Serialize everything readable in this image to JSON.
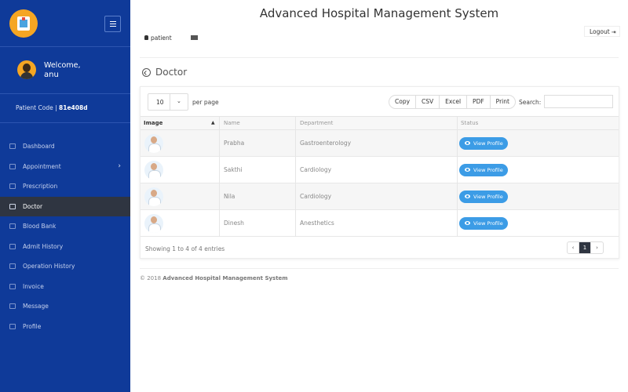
{
  "app": {
    "title": "Advanced Hospital Management System"
  },
  "sidebar": {
    "welcome": "Welcome,",
    "username": "anu",
    "patient_code_label": "Patient Code |",
    "patient_code_value": "81e408d",
    "items": [
      {
        "label": "Dashboard",
        "icon": "monitor-icon"
      },
      {
        "label": "Appointment",
        "icon": "edit-icon",
        "has_submenu": true
      },
      {
        "label": "Prescription",
        "icon": "stethoscope-icon"
      },
      {
        "label": "Doctor",
        "icon": "user-md-icon",
        "active": true
      },
      {
        "label": "Blood Bank",
        "icon": "drop-icon"
      },
      {
        "label": "Admit History",
        "icon": "history-icon"
      },
      {
        "label": "Operation History",
        "icon": "operation-icon"
      },
      {
        "label": "Invoice",
        "icon": "credit-card-icon"
      },
      {
        "label": "Message",
        "icon": "chat-icon"
      },
      {
        "label": "Profile",
        "icon": "user-icon"
      }
    ]
  },
  "header": {
    "user_label": "patient",
    "logout_label": "Logout"
  },
  "page": {
    "title": "Doctor"
  },
  "controls": {
    "page_length": "10",
    "per_page_label": "per page",
    "buttons": [
      "Copy",
      "CSV",
      "Excel",
      "PDF",
      "Print"
    ],
    "search_label": "Search:"
  },
  "table": {
    "columns": [
      "Image",
      "Name",
      "Department",
      "Status"
    ],
    "rows": [
      {
        "name": "Prabha",
        "department": "Gastroenterology",
        "status": "View Profile"
      },
      {
        "name": "Sakthi",
        "department": "Cardiology",
        "status": "View Profile"
      },
      {
        "name": "Nila",
        "department": "Cardiology",
        "status": "View Profile"
      },
      {
        "name": "Dinesh",
        "department": "Anesthetics",
        "status": "View Profile"
      }
    ]
  },
  "info": "Showing 1 to 4 of 4 entries",
  "pagination": {
    "prev": "‹",
    "current": "1",
    "next": "›"
  },
  "footer": {
    "prefix": "© 2018",
    "name": "Advanced Hospital Management System"
  },
  "colors": {
    "sidebar": "#0f3a99",
    "accent": "#3c9ce6",
    "active": "#2f3541"
  }
}
